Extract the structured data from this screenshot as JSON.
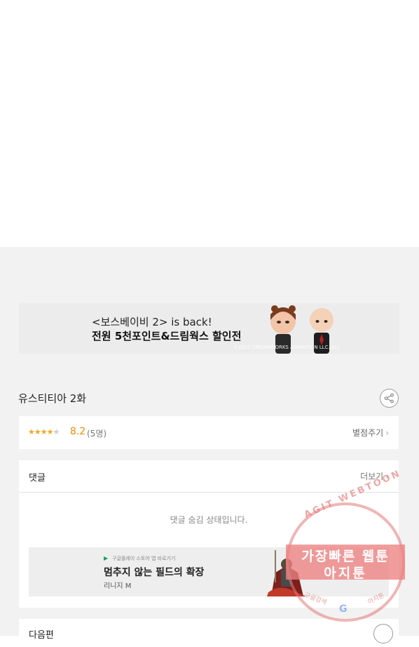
{
  "banner_ad": {
    "line1": "<보스베이비 2> is back!",
    "line2": "전원 5천포인트&드림웍스 할인전",
    "copyright": "©2021 DREAMWORKS ANIMATION LLC. ALL"
  },
  "episode": {
    "title": "유스티티아 2화",
    "share_icon": "share-icon"
  },
  "rating": {
    "filled_stars": 4,
    "total_stars": 5,
    "score": "8.2",
    "count": "(5명)",
    "rate_label": "별점주기",
    "chevron": "›"
  },
  "comments": {
    "title": "댓글",
    "more_label": "더보기",
    "chevron": "›",
    "hidden_message": "댓글 숨김 상태입니다."
  },
  "inner_ad": {
    "store_text": "구글플레이 스토어 앱 바로가기",
    "headline": "멈추지 않는 필드의 확장",
    "brand": "리니지 M"
  },
  "next": {
    "title": "다음편"
  },
  "watermark": {
    "top_text": "AGIT WEBTOON",
    "line1": "가장빠른 웹툰",
    "line2": "아지툰",
    "bottom_left": "구글검색",
    "bottom_right": "아지툰",
    "g_letter": "G"
  },
  "colors": {
    "accent_orange": "#f08c00",
    "star_color": "#f5a623",
    "background_gray": "#f2f2f2",
    "watermark_pink": "#e67878"
  }
}
